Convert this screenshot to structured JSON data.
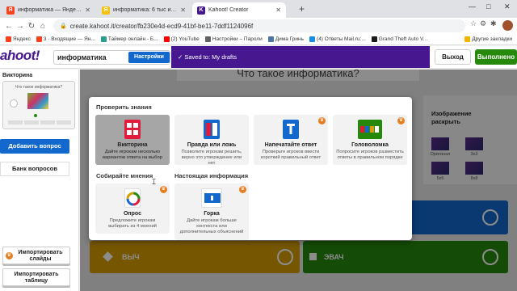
{
  "browser": {
    "tabs": [
      {
        "title": "информатика — Яндекс: нашл",
        "favicon": "Я",
        "color": "#fc3f1d"
      },
      {
        "title": "информатика: 6 тыс изображе",
        "favicon": "Я",
        "color": "#f4c20d"
      },
      {
        "title": "Kahoot! Creator",
        "favicon": "K",
        "color": "#46178f"
      }
    ],
    "new_tab": "+",
    "window_controls": [
      "—",
      "□",
      "✕"
    ],
    "url": "create.kahoot.it/creator/fb230e4d-ecd9-41bf-be11-7ddf1124096f",
    "bookmarks": [
      {
        "label": "Яндекс",
        "color": "#fc3f1d"
      },
      {
        "label": "3 · Входящие — Ян...",
        "color": "#fc3f1d"
      },
      {
        "label": "Таймер онлайн - Б...",
        "color": "#2a9d8f"
      },
      {
        "label": "(2) YouTube",
        "color": "#ff0000"
      },
      {
        "label": "Настройки – Пароли",
        "color": "#5f6368"
      },
      {
        "label": "Дима Гринь",
        "color": "#4c75a3"
      },
      {
        "label": "(4) Ответы Mail.ru:...",
        "color": "#168de2"
      },
      {
        "label": "Grand Theft Auto V...",
        "color": "#1a1a1a"
      },
      {
        "label": "Другие закладки",
        "color": "#f4b400"
      }
    ]
  },
  "kahoot": {
    "logo": "ahoot!",
    "title_value": "информатика",
    "settings_label": "Настройки",
    "saved_text": "✓  Saved to: My drafts",
    "exit_label": "Выход",
    "done_label": "Выполнено"
  },
  "sidebar": {
    "question_type": "Викторина",
    "question_preview": "Что такое информатика?",
    "add_question": "Добавить вопрос",
    "question_bank": "Банк вопросов",
    "import_slides": "Импортировать слайды",
    "import_table": "Импортировать таблицу"
  },
  "canvas": {
    "question_title": "Что такое информатика?",
    "image_reveal_title": "Изображение раскрыть",
    "reveal_options": [
      "Оригинал",
      "3x3",
      "5x5",
      "8x8"
    ],
    "answer_yellow": "ВЫЧ",
    "answer_green": "ЭВАЧ"
  },
  "modal": {
    "section_test": "Проверить знания",
    "section_opinion": "Собирайте мнения",
    "section_info": "Настоящая информация",
    "options": [
      {
        "name": "Викторина",
        "desc": "Дайте игрокам несколько вариантов ответа на выбор",
        "icon_color": "#e21b3c"
      },
      {
        "name": "Правда или ложь",
        "desc": "Позволите игрокам решить, верно это утверждение или нет",
        "icon_color": "#1368ce"
      },
      {
        "name": "Напечатайте ответ",
        "desc": "Проверьте игроков ввести короткий правильный ответ",
        "icon_color": "#1368ce"
      },
      {
        "name": "Головоломка",
        "desc": "Попросите игроков разместить ответы в правильном порядке",
        "icon_color": "#26890c"
      },
      {
        "name": "Опрос",
        "desc": "Предложите игрокам выбирать из 4 мнений",
        "icon_color": "#d89e00"
      },
      {
        "name": "Горка",
        "desc": "Дайте игрокам больше контекста или дополнительных объяснений",
        "icon_color": "#1368ce"
      }
    ]
  }
}
